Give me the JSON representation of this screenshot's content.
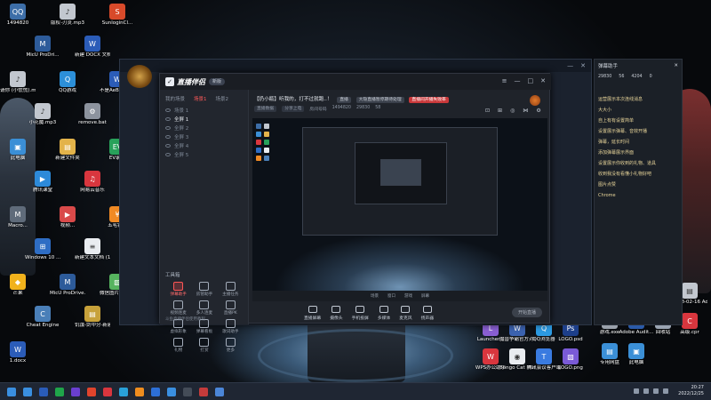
{
  "desktop": {
    "icons_left": [
      {
        "label": "1494820",
        "color": "#3d6ea8",
        "glyph": "QQ"
      },
      {
        "label": "MicU ProDri...",
        "color": "#2d5b9a",
        "glyph": "M"
      },
      {
        "label": "版权-刃炎.mp3",
        "color": "#c2c7cf",
        "glyph": "♪"
      },
      {
        "label": "新建 DOCX 文档 (2).d...",
        "color": "#2b5cb8",
        "glyph": "W"
      },
      {
        "label": "SunloginCl...",
        "color": "#d84a2a",
        "glyph": "S"
      },
      {
        "label": "请你 (小慌慌).mp3",
        "color": "#c2c7cf",
        "glyph": "♪"
      },
      {
        "label": "小花魔.mp3",
        "color": "#c2c7cf",
        "glyph": "♪"
      },
      {
        "label": "QQ游戏",
        "color": "#2c8fd8",
        "glyph": "Q"
      },
      {
        "label": "remove.bat",
        "color": "#8c939e",
        "glyph": "⚙"
      },
      {
        "label": "不是AeBMy 教程.docx",
        "color": "#2b5cb8",
        "glyph": "W"
      },
      {
        "label": "此电脑",
        "color": "#3b8fd6",
        "glyph": "▣"
      },
      {
        "label": "腾讯课堂",
        "color": "#2d8ad9",
        "glyph": "▶"
      },
      {
        "label": "新建文件夹",
        "color": "#e3b34a",
        "glyph": "▤"
      },
      {
        "label": "网易云音乐",
        "color": "#d9363e",
        "glyph": "♫"
      },
      {
        "label": "EV录屏",
        "color": "#28a15a",
        "glyph": "EV"
      },
      {
        "label": "Macro...",
        "color": "#5f6b7a",
        "glyph": "M"
      },
      {
        "label": "Windows 10 ...",
        "color": "#2e6dc4",
        "glyph": "⊞"
      },
      {
        "label": "视频...",
        "color": "#d94a4a",
        "glyph": "▶"
      },
      {
        "label": "新建文本文档 (14).txt",
        "color": "#e9ecf0",
        "glyph": "≡"
      },
      {
        "label": "五毛钱...",
        "color": "#f08a24",
        "glyph": "¥"
      },
      {
        "label": "芒果",
        "color": "#f1b21c",
        "glyph": "◆"
      },
      {
        "label": "Cheat Engine",
        "color": "#4a7fb8",
        "glyph": "C"
      },
      {
        "label": "MicU ProDrive...",
        "color": "#2d5b9a",
        "glyph": "M"
      },
      {
        "label": "饥饿-剑中分·新建工具...",
        "color": "#c7a13a",
        "glyph": "▤"
      },
      {
        "label": "微信图片_2022080...",
        "color": "#56b35f",
        "glyph": "▧"
      },
      {
        "label": "1.docx",
        "color": "#2b5cb8",
        "glyph": "W"
      }
    ],
    "icons_bottom": [
      {
        "label": "Launcher...",
        "color": "#8a5fd2",
        "glyph": "L"
      },
      {
        "label": "魔兽争霸官方对战平台",
        "color": "#3c63b0",
        "glyph": "W"
      },
      {
        "label": "QQ浏览器",
        "color": "#2d9be3",
        "glyph": "Q"
      },
      {
        "label": "LOGO.psd",
        "color": "#1d3f8a",
        "glyph": "Ps"
      },
      {
        "label": "WPS办公助手",
        "color": "#d9363e",
        "glyph": "W"
      },
      {
        "label": "Bongo Cat Mver.exe",
        "color": "#e9ecf0",
        "glyph": "◉"
      },
      {
        "label": "腾讯会议客户端",
        "color": "#3a7be0",
        "glyph": "T"
      },
      {
        "label": "LOGO.png",
        "color": "#7a5ad6",
        "glyph": "▧"
      }
    ],
    "icons_right": [
      {
        "label": "Chrome",
        "color": "#3c9d4a",
        "glyph": "◎"
      },
      {
        "label": "电脑小管家.txt",
        "color": "#e9ecf0",
        "glyph": "≡"
      },
      {
        "label": "pv2...",
        "color": "#2c7ed4",
        "glyph": "▣"
      },
      {
        "label": "2018-02-16 Administr...",
        "color": "#c2c7cf",
        "glyph": "▤"
      },
      {
        "label": "游戏.exe",
        "color": "#9aa1ab",
        "glyph": "▣"
      },
      {
        "label": "Adobe Audit...",
        "color": "#2b5aa8",
        "glyph": "Au"
      },
      {
        "label": "回收站",
        "color": "#9aa4b2",
        "glyph": "♻"
      },
      {
        "label": "高级.cpr",
        "color": "#d9363e",
        "glyph": "C"
      },
      {
        "label": "专用网盘",
        "color": "#3b8fd6",
        "glyph": "▤"
      },
      {
        "label": "此电脑",
        "color": "#3b8fd6",
        "glyph": "▣"
      }
    ]
  },
  "app": {
    "name": "直播伴侣",
    "badge": "新版",
    "room_title": "【扔小瓶】听我的，打不过就跑..！",
    "pill_tag": "直播",
    "pill_warning": "大隐直播暂停期待处理",
    "pill_hot": "直播间开播失败率",
    "meta": {
      "channel": "直播数据",
      "share": "分享上电",
      "room_id_label": "房间号码",
      "room_id": "1494820",
      "fans": "29830",
      "online": "58"
    }
  },
  "left_panel": {
    "tabs": [
      "我的场景",
      "场景1",
      "场景2"
    ],
    "active_tab_index": 1,
    "scenes": [
      "场景 1",
      "全屏 1",
      "全屏 2",
      "全屏 3",
      "全屏 4",
      "全屏 5"
    ],
    "selected_scene_index": 1,
    "tools_title": "工具箱",
    "tools": [
      {
        "label": "弹幕助手",
        "hot": true
      },
      {
        "label": "房管助手",
        "hot": false
      },
      {
        "label": "主播任务",
        "hot": false
      },
      {
        "label": "视频连麦",
        "hot": false
      },
      {
        "label": "多人连麦",
        "hot": false
      },
      {
        "label": "直播PK",
        "hot": false
      },
      {
        "label": "虚拟形象",
        "hot": false
      },
      {
        "label": "弹幕看板",
        "hot": false
      },
      {
        "label": "歌词助手",
        "hot": false
      },
      {
        "label": "礼物",
        "hot": false
      },
      {
        "label": "打赏",
        "hot": false
      },
      {
        "label": "更多",
        "hot": false
      }
    ],
    "footer": "斗鱼直播伴侣使用教程"
  },
  "preview": {
    "toolbar": [
      "场景",
      "窗口",
      "游戏",
      "屏幕"
    ]
  },
  "bottom_bar": {
    "items": [
      "直播屏幕",
      "摄像头",
      "手机投屏",
      "多媒体",
      "麦克风",
      "扬声器"
    ],
    "start_button": "开始直播"
  },
  "danmu": {
    "title": "弹幕助手",
    "stats": [
      "29830",
      "56",
      "4204",
      "0"
    ],
    "lines": [
      "运营展示本次连线消息",
      "大大小",
      "自上有有设置简单",
      "设置展示弹幕、音效开播",
      "弹幕，延长时间",
      "添加弹幕展示界面",
      "设置展示你收到的礼物、道具",
      "收到我没有看懂小礼物好吧",
      "图片点赞",
      "Chrome"
    ]
  },
  "taskbar": {
    "time": "20:27",
    "date": "2022/12/25",
    "pinned_colors": [
      "#3a8fe0",
      "#2a5cb8",
      "#1fa54a",
      "#6a3fd0",
      "#e0442c",
      "#d9363e",
      "#29a1d8",
      "#ef8d1e",
      "#2d6fd6",
      "#3a8fe0",
      "#444c58",
      "#c43b3b",
      "#4b86d8"
    ]
  }
}
